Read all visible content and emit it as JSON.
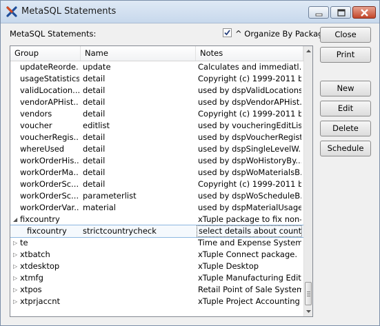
{
  "window": {
    "title": "MetaSQL Statements",
    "app_icon": "xtuple-x-icon",
    "controls": [
      "minimize-icon",
      "maximize-icon",
      "close-icon"
    ]
  },
  "header": {
    "label": "MetaSQL Statements:",
    "organize_checked": true,
    "organize_label": "^ Organize By Package"
  },
  "buttons": {
    "close": "Close",
    "print": "Print",
    "new": "New",
    "edit": "Edit",
    "delete": "Delete",
    "schedule": "Schedule"
  },
  "tree": {
    "columns": [
      "Group",
      "Name",
      "Notes"
    ],
    "rows": [
      {
        "group": "updateReorde...",
        "name": "update",
        "notes": "Calculates and immediatl..."
      },
      {
        "group": "usageStatistics",
        "name": "detail",
        "notes": "Copyright (c) 1999-2011 b..."
      },
      {
        "group": "validLocation...",
        "name": "detail",
        "notes": "used by dspValidLocations..."
      },
      {
        "group": "vendorAPHist...",
        "name": "detail",
        "notes": "used by dspVendorAPHist..."
      },
      {
        "group": "vendors",
        "name": "detail",
        "notes": "Copyright (c) 1999-2011 b..."
      },
      {
        "group": "voucher",
        "name": "editlist",
        "notes": "used by voucheringEditLis..."
      },
      {
        "group": "voucherRegis...",
        "name": "detail",
        "notes": "used by dspVoucherRegist..."
      },
      {
        "group": "whereUsed",
        "name": "detail",
        "notes": "used by dspSingleLevelW..."
      },
      {
        "group": "workOrderHis...",
        "name": "detail",
        "notes": "used by dspWoHistoryBy..."
      },
      {
        "group": "workOrderMa...",
        "name": "detail",
        "notes": "used by dspWoMaterialsB..."
      },
      {
        "group": "workOrderSc...",
        "name": "detail",
        "notes": "Copyright (c) 1999-2011 b..."
      },
      {
        "group": "workOrderSc...",
        "name": "parameterlist",
        "notes": "used by dspWoScheduleB..."
      },
      {
        "group": "workOrderVar...",
        "name": "material",
        "notes": "used by dspMaterialUsage..."
      }
    ],
    "packages": [
      {
        "group": "fixcountry",
        "notes": "xTuple package to fix non-...",
        "expanded": true
      },
      {
        "group": "te",
        "notes": "Time and Expense System",
        "expanded": false
      },
      {
        "group": "xtbatch",
        "notes": "xTuple Connect package.",
        "expanded": false
      },
      {
        "group": "xtdesktop",
        "notes": "xTuple Desktop",
        "expanded": false
      },
      {
        "group": "xtmfg",
        "notes": "xTuple Manufacturing Edit...",
        "expanded": false
      },
      {
        "group": "xtpos",
        "notes": "Retail Point of Sale System",
        "expanded": false
      },
      {
        "group": "xtprjaccnt",
        "notes": "xTuple Project Accounting",
        "expanded": false
      }
    ],
    "selected_child": {
      "group": "fixcountry",
      "name": "strictcountrycheck",
      "notes": "select details about countr..."
    }
  }
}
